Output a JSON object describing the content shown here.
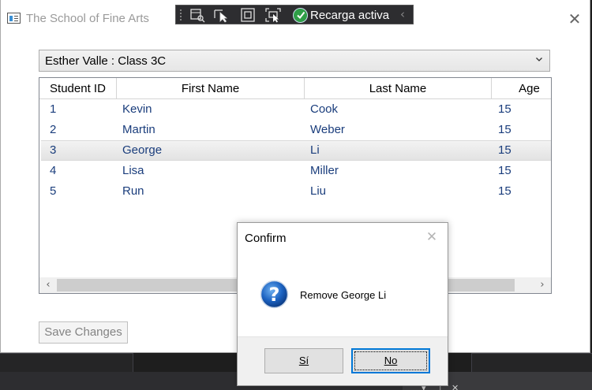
{
  "window": {
    "title": "The School of Fine Arts",
    "close_glyph": "✕"
  },
  "debug_toolbar": {
    "status_label": "Recarga activa",
    "collapse_glyph": "‹",
    "tools": [
      "select-element-icon",
      "pointer-select-icon",
      "display-layout-adorners-icon",
      "track-focus-icon"
    ],
    "status_icon": "check-circle-icon"
  },
  "class_selector": {
    "value": "Esther Valle : Class 3C"
  },
  "grid": {
    "columns": [
      "Student ID",
      "First Name",
      "Last Name",
      "Age"
    ],
    "rows": [
      {
        "id": "1",
        "first": "Kevin",
        "last": "Cook",
        "age": "15"
      },
      {
        "id": "2",
        "first": "Martin",
        "last": "Weber",
        "age": "15"
      },
      {
        "id": "3",
        "first": "George",
        "last": "Li",
        "age": "15"
      },
      {
        "id": "4",
        "first": "Lisa",
        "last": "Miller",
        "age": "15"
      },
      {
        "id": "5",
        "first": "Run",
        "last": "Liu",
        "age": "15"
      }
    ],
    "selected_row": 3,
    "scroll_left_glyph": "‹",
    "scroll_right_glyph": "›"
  },
  "save_button": {
    "label": "Save Changes"
  },
  "dialog": {
    "title": "Confirm",
    "message": "Remove George Li",
    "yes_label": "Sí",
    "no_label": "No",
    "close_glyph": "✕",
    "icon": "question-icon"
  },
  "ide_controls": {
    "dropdown_glyph": "▾",
    "pin_glyph": "⊥",
    "close_glyph": "✕"
  },
  "colors": {
    "accent": "#0078d7",
    "grid_text": "#1a3d7c",
    "status_ok": "#2e9e46"
  }
}
